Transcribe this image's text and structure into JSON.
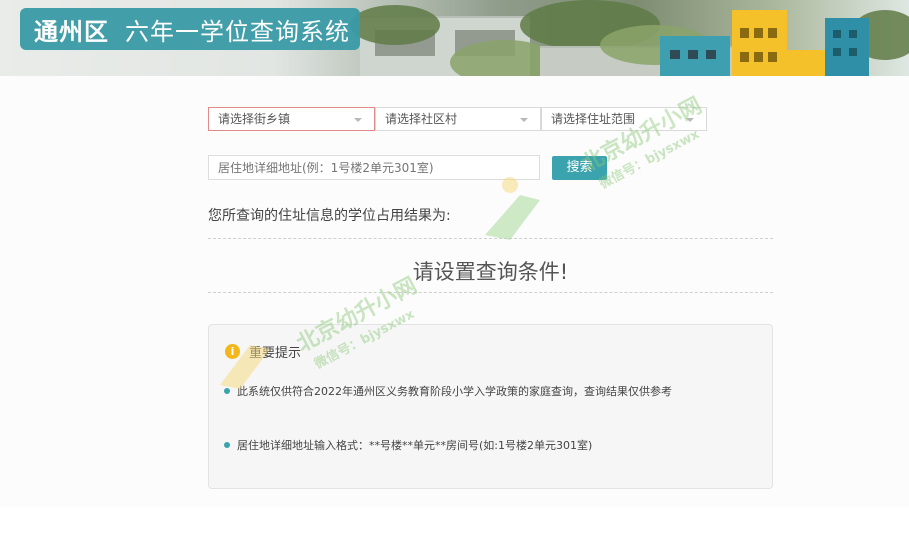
{
  "header": {
    "district": "通州区",
    "system_title": "六年一学位查询系统"
  },
  "filters": {
    "street": "请选择街乡镇",
    "community": "请选择社区村",
    "range": "请选择住址范围"
  },
  "search": {
    "placeholder": "居住地详细地址(例：1号楼2单元301室)",
    "button_label": "搜索"
  },
  "result": {
    "label": "您所查询的住址信息的学位占用结果为:",
    "message": "请设置查询条件!"
  },
  "notice": {
    "title": "重要提示",
    "icon_glyph": "i",
    "items": [
      "此系统仅供符合2022年通州区义务教育阶段小学入学政策的家庭查询，查询结果仅供参考",
      "居住地详细地址输入格式：**号楼**单元**房间号(如:1号楼2单元301室)"
    ]
  },
  "watermark": {
    "name": "北京幼升小网",
    "wechat": "微信号：bjysxwx"
  },
  "colors": {
    "accent": "#3aa3ad",
    "warning": "#f3b71a",
    "active_border": "#e08a8a"
  }
}
